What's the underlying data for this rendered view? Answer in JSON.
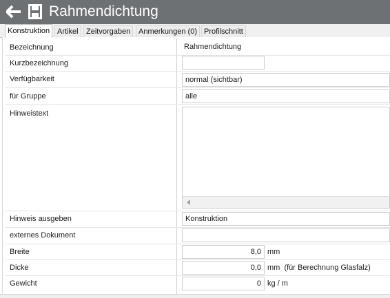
{
  "window": {
    "title": "Rahmendichtung"
  },
  "icons": {
    "back": "arrow-left-icon",
    "save": "floppy-disk-icon"
  },
  "colors": {
    "titlebar": "#6d7174"
  },
  "tabs": [
    {
      "label": "Konstruktion",
      "active": true
    },
    {
      "label": "Artikel",
      "active": false
    },
    {
      "label": "Zeitvorgaben",
      "active": false
    },
    {
      "label": "Anmerkungen (0)",
      "active": false
    },
    {
      "label": "Profilschnitt",
      "active": false
    }
  ],
  "form": {
    "bezeichnung": {
      "label": "Bezeichnung",
      "value": "Rahmendichtung"
    },
    "kurzbezeichnung": {
      "label": "Kurzbezeichnung",
      "value": ""
    },
    "verfuegbarkeit": {
      "label": "Verfügbarkeit",
      "value": "normal (sichtbar)"
    },
    "gruppe": {
      "label": "für Gruppe",
      "value": "alle"
    },
    "hinweistext": {
      "label": "Hinweistext",
      "value": ""
    },
    "hinweis_ausgeben": {
      "label": "Hinweis ausgeben",
      "value": "Konstruktion"
    },
    "externes_dokument": {
      "label": "externes Dokument",
      "value": ""
    },
    "breite": {
      "label": "Breite",
      "value": "8,0",
      "unit": "mm"
    },
    "dicke": {
      "label": "Dicke",
      "value": "0,0",
      "unit": "mm  (für Berechnung Glasfalz)"
    },
    "gewicht": {
      "label": "Gewicht",
      "value": "0",
      "unit": "kg / m"
    }
  }
}
